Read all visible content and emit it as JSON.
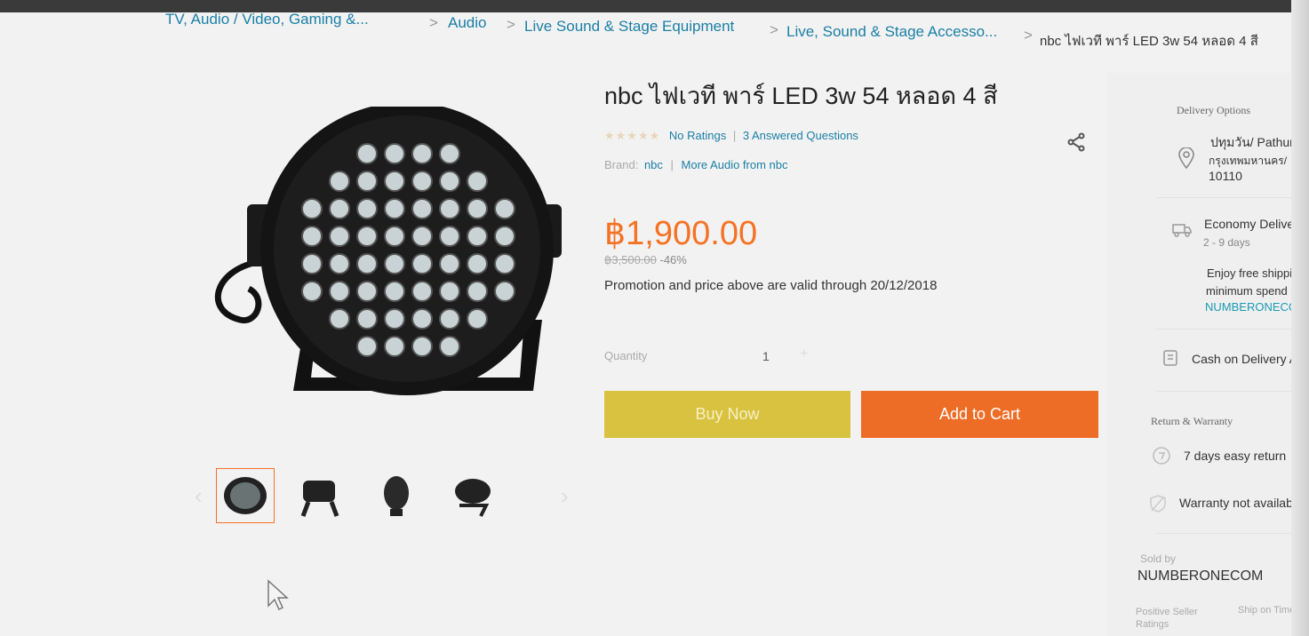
{
  "breadcrumb": {
    "items": [
      "TV, Audio / Video, Gaming &...",
      "Audio",
      "Live Sound & Stage Equipment",
      "Live, Sound & Stage Accesso...",
      "nbc ไฟเวที พาร์ LED 3w 54 หลอด 4 สี"
    ]
  },
  "product": {
    "title": "nbc ไฟเวที พาร์ LED 3w 54 หลอด 4 สี",
    "stars": "★★★★★",
    "ratings_link": "No Ratings",
    "separator": "|",
    "questions_link": "3 Answered Questions",
    "brand_label": "Brand:",
    "brand_link": "nbc",
    "more_link": "More Audio from nbc",
    "price": "฿1,900.00",
    "original_price": "฿3,500.00",
    "discount": "-46%",
    "promo_text": "Promotion and price above are valid through 20/12/2018",
    "quantity_label": "Quantity",
    "quantity_value": "1",
    "quantity_plus": "+",
    "buy_now": "Buy Now",
    "add_to_cart": "Add to Cart"
  },
  "gallery": {
    "prev_arrow": "‹",
    "next_arrow": "›",
    "thumbnail_count": 4
  },
  "delivery": {
    "header": "Delivery Options",
    "location_line1": "ปทุมวัน/ Pathum",
    "location_line2": "กรุงเทพมหานคร/",
    "location_line3": "10110",
    "economy_title": "Economy Delive",
    "economy_days": "2 - 9 days",
    "free_ship_line1": "Enjoy free shippir",
    "free_ship_line2": "minimum spend o",
    "free_ship_code": "NUMBERONECO",
    "cod": "Cash on Delivery A"
  },
  "warranty": {
    "header": "Return & Warranty",
    "return_text": "7 days easy return",
    "warranty_text": "Warranty not availab"
  },
  "seller": {
    "label": "Sold by",
    "name": "NUMBERONECOM",
    "positive_label": "Positive Seller",
    "positive_label2": "Ratings",
    "ship_on_time": "Ship on Time"
  },
  "colors": {
    "accent": "#f57224",
    "link": "#1b7fa6",
    "buy_now": "#d9c23f",
    "add_to_cart": "#ee6d26"
  }
}
